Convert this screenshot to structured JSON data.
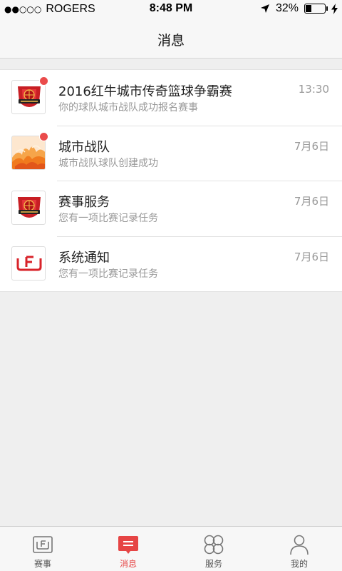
{
  "status_bar": {
    "signal": "●●○○○",
    "carrier": "ROGERS",
    "time": "8:48 PM",
    "battery": "32%",
    "battery_level": 0.32
  },
  "nav": {
    "title": "消息"
  },
  "messages": [
    {
      "title": "2016红牛城市传奇篮球争霸赛",
      "subtitle": "你的球队城市战队成功报名赛事",
      "time": "13:30",
      "unread": true,
      "icon": "basketball-crest-icon"
    },
    {
      "title": "城市战队",
      "subtitle": "城市战队球队创建成功",
      "time": "7月6日",
      "unread": true,
      "icon": "flame-icon"
    },
    {
      "title": "赛事服务",
      "subtitle": "您有一项比赛记录任务",
      "time": "7月6日",
      "unread": false,
      "icon": "basketball-crest-icon"
    },
    {
      "title": "系统通知",
      "subtitle": "您有一项比赛记录任务",
      "time": "7月6日",
      "unread": false,
      "icon": "app-logo-icon"
    }
  ],
  "tabs": [
    {
      "label": "赛事",
      "icon": "match-icon",
      "active": false
    },
    {
      "label": "消息",
      "icon": "message-icon",
      "active": true
    },
    {
      "label": "服务",
      "icon": "service-icon",
      "active": false
    },
    {
      "label": "我的",
      "icon": "profile-icon",
      "active": false
    }
  ],
  "colors": {
    "accent": "#e64545",
    "unread_dot": "#ea4b4b",
    "background": "#efefef"
  }
}
